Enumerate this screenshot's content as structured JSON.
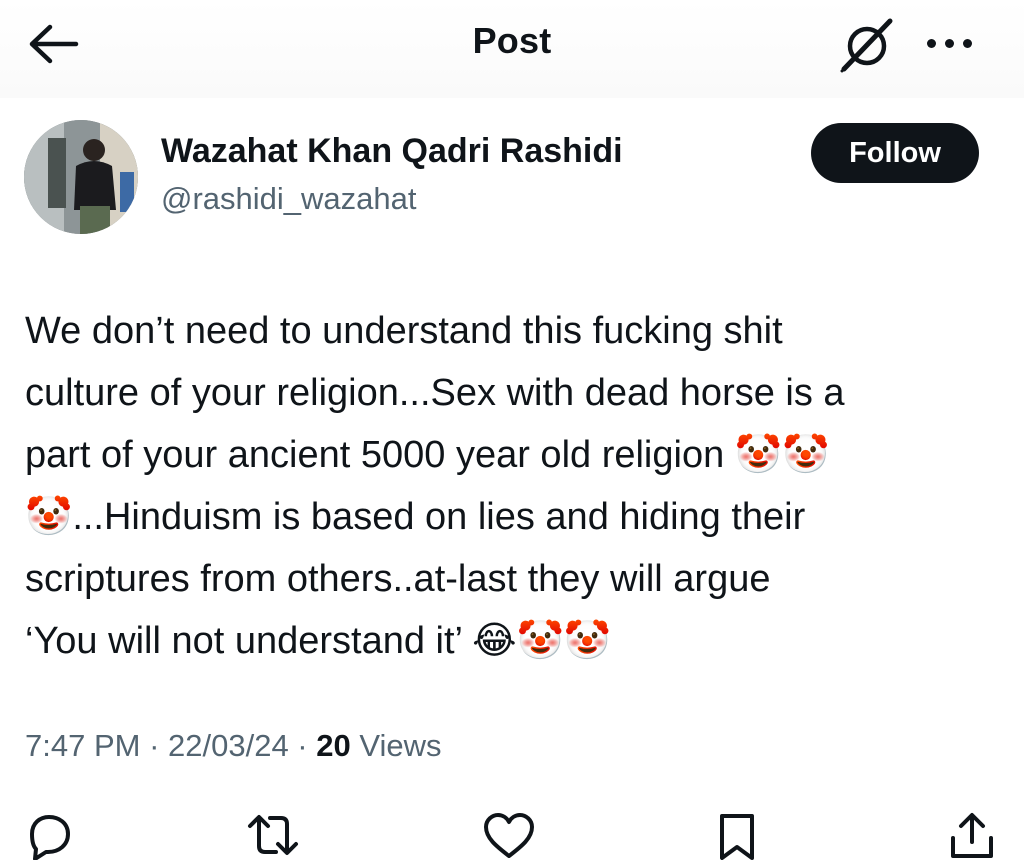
{
  "header": {
    "title": "Post",
    "back_icon": "arrow-left-icon",
    "grok_icon": "grok-icon",
    "more_icon": "more-horizontal-icon"
  },
  "author": {
    "display_name": "Wazahat Khan Qadri Rashidi",
    "handle": "@rashidi_wazahat",
    "follow_label": "Follow"
  },
  "post": {
    "text": "We don’t need to understand this fucking shit\nculture of your religion...Sex with dead horse is a\npart of your ancient 5000 year old religion 🤡🤡\n🤡...Hinduism is based on lies and hiding their\nscriptures from others..at-last they will argue\n‘You will not understand it’ 😂🤡🤡",
    "time": "7:47 PM",
    "date": "22/03/24",
    "separator": " · ",
    "views_count": "20",
    "views_label": " Views"
  },
  "actions": [
    {
      "name": "reply",
      "icon": "reply-icon"
    },
    {
      "name": "repost",
      "icon": "repost-icon"
    },
    {
      "name": "like",
      "icon": "heart-icon"
    },
    {
      "name": "bookmark",
      "icon": "bookmark-icon"
    },
    {
      "name": "share",
      "icon": "share-icon"
    }
  ],
  "colors": {
    "text_primary": "#0f1419",
    "text_secondary": "#536471",
    "follow_bg": "#0f1419"
  }
}
